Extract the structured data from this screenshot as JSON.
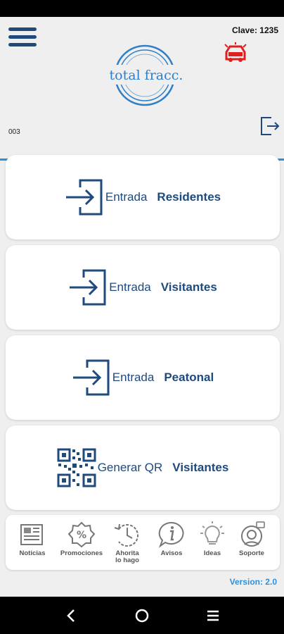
{
  "header": {
    "clave_text": "Clave: 1235",
    "logo_text": "total fracc.",
    "unit_code": "003"
  },
  "cards": [
    {
      "label": "Entrada",
      "strong": "Residentes",
      "icon": "enter-icon"
    },
    {
      "label": "Entrada",
      "strong": "Visitantes",
      "icon": "enter-icon"
    },
    {
      "label": "Entrada",
      "strong": "Peatonal",
      "icon": "enter-icon"
    },
    {
      "label": "Generar QR",
      "strong": "Visitantes",
      "icon": "qr-code-icon"
    }
  ],
  "tabs": [
    {
      "label": "Noticias",
      "icon": "newspaper-icon"
    },
    {
      "label": "Promociones",
      "icon": "percent-badge-icon"
    },
    {
      "label": "Ahorita\nlo hago",
      "icon": "clock-history-icon"
    },
    {
      "label": "Avisos",
      "icon": "info-bubble-icon"
    },
    {
      "label": "Ideas",
      "icon": "lightbulb-icon"
    },
    {
      "label": "Soporte",
      "icon": "support-agent-icon"
    }
  ],
  "footer": {
    "version_text": "Version: 2.0"
  },
  "colors": {
    "primary": "#1f4a7c",
    "accent": "#2f8fd8",
    "alarm": "#e02020"
  }
}
